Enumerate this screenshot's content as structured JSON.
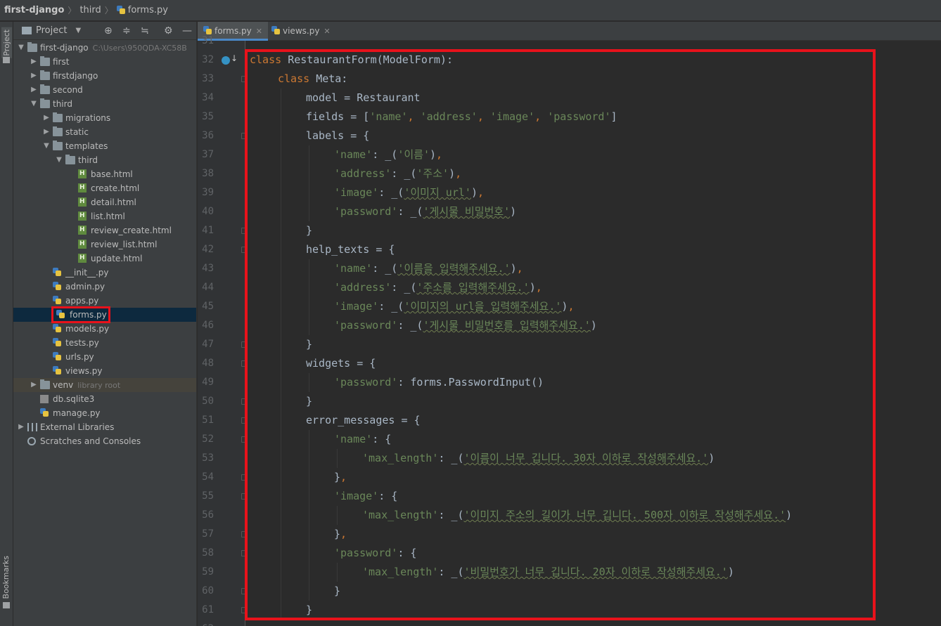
{
  "breadcrumb": [
    "first-django",
    "third",
    "forms.py"
  ],
  "sidebar_strip": {
    "project_label": "Project",
    "bookmarks_label": "Bookmarks"
  },
  "project_panel": {
    "title": "Project"
  },
  "tree": [
    {
      "label": "first-django",
      "hint": "C:\\Users\\950QDA-XC58B",
      "depth": 0,
      "arrow": "down",
      "icon": "folder-icon"
    },
    {
      "label": "first",
      "depth": 1,
      "arrow": "right",
      "icon": "folder-icon"
    },
    {
      "label": "firstdjango",
      "depth": 1,
      "arrow": "right",
      "icon": "folder-icon"
    },
    {
      "label": "second",
      "depth": 1,
      "arrow": "right",
      "icon": "folder-icon"
    },
    {
      "label": "third",
      "depth": 1,
      "arrow": "down",
      "icon": "folder-icon"
    },
    {
      "label": "migrations",
      "depth": 2,
      "arrow": "right",
      "icon": "folder-icon"
    },
    {
      "label": "static",
      "depth": 2,
      "arrow": "right",
      "icon": "folder-icon"
    },
    {
      "label": "templates",
      "depth": 2,
      "arrow": "down",
      "icon": "folder-icon"
    },
    {
      "label": "third",
      "depth": 3,
      "arrow": "down",
      "icon": "folder-icon"
    },
    {
      "label": "base.html",
      "depth": 4,
      "icon": "html-file-icon"
    },
    {
      "label": "create.html",
      "depth": 4,
      "icon": "html-file-icon"
    },
    {
      "label": "detail.html",
      "depth": 4,
      "icon": "html-file-icon"
    },
    {
      "label": "list.html",
      "depth": 4,
      "icon": "html-file-icon"
    },
    {
      "label": "review_create.html",
      "depth": 4,
      "icon": "html-file-icon"
    },
    {
      "label": "review_list.html",
      "depth": 4,
      "icon": "html-file-icon"
    },
    {
      "label": "update.html",
      "depth": 4,
      "icon": "html-file-icon"
    },
    {
      "label": "__init__.py",
      "depth": 2,
      "icon": "python-file-icon"
    },
    {
      "label": "admin.py",
      "depth": 2,
      "icon": "python-file-icon"
    },
    {
      "label": "apps.py",
      "depth": 2,
      "icon": "python-file-icon"
    },
    {
      "label": "forms.py",
      "depth": 2,
      "icon": "python-file-icon",
      "selected": true
    },
    {
      "label": "models.py",
      "depth": 2,
      "icon": "python-file-icon"
    },
    {
      "label": "tests.py",
      "depth": 2,
      "icon": "python-file-icon"
    },
    {
      "label": "urls.py",
      "depth": 2,
      "icon": "python-file-icon"
    },
    {
      "label": "views.py",
      "depth": 2,
      "icon": "python-file-icon"
    },
    {
      "label": "venv",
      "hint": "library root",
      "depth": 1,
      "arrow": "right",
      "icon": "folder-icon",
      "venv": true
    },
    {
      "label": "db.sqlite3",
      "depth": 1,
      "icon": "database-icon"
    },
    {
      "label": "manage.py",
      "depth": 1,
      "icon": "python-file-icon"
    },
    {
      "label": "External Libraries",
      "depth": 0,
      "arrow": "right",
      "icon": "library-icon"
    },
    {
      "label": "Scratches and Consoles",
      "depth": 0,
      "icon": "scratch-icon"
    }
  ],
  "editor_tabs": [
    {
      "label": "forms.py",
      "active": true,
      "closable": true
    },
    {
      "label": "views.py",
      "active": false,
      "closable": true
    }
  ],
  "code": {
    "first_line_number": 31,
    "lines": [
      {
        "n": 31,
        "indent": 0,
        "parts": []
      },
      {
        "n": 32,
        "indent": 0,
        "parts": [
          [
            "kw",
            "class "
          ],
          [
            "cls",
            "RestaurantForm(ModelForm):"
          ]
        ]
      },
      {
        "n": 33,
        "indent": 1,
        "parts": [
          [
            "kw",
            "class "
          ],
          [
            "cls",
            "Meta:"
          ]
        ]
      },
      {
        "n": 34,
        "indent": 2,
        "parts": [
          [
            "cls",
            "model = Restaurant"
          ]
        ]
      },
      {
        "n": 35,
        "indent": 2,
        "parts": [
          [
            "cls",
            "fields = ["
          ],
          [
            "str",
            "'name'"
          ],
          [
            "punc",
            ", "
          ],
          [
            "str",
            "'address'"
          ],
          [
            "punc",
            ", "
          ],
          [
            "str",
            "'image'"
          ],
          [
            "punc",
            ", "
          ],
          [
            "str",
            "'password'"
          ],
          [
            "cls",
            "]"
          ]
        ]
      },
      {
        "n": 36,
        "indent": 2,
        "parts": [
          [
            "cls",
            "labels = {"
          ]
        ]
      },
      {
        "n": 37,
        "indent": 3,
        "parts": [
          [
            "str",
            "'name'"
          ],
          [
            "cls",
            ": _("
          ],
          [
            "str",
            "'이름'"
          ],
          [
            "cls",
            ")"
          ],
          [
            "punc",
            ","
          ]
        ]
      },
      {
        "n": 38,
        "indent": 3,
        "parts": [
          [
            "str",
            "'address'"
          ],
          [
            "cls",
            ": _("
          ],
          [
            "str",
            "'주소'"
          ],
          [
            "cls",
            ")"
          ],
          [
            "punc",
            ","
          ]
        ]
      },
      {
        "n": 39,
        "indent": 3,
        "parts": [
          [
            "str",
            "'image'"
          ],
          [
            "cls",
            ": _("
          ],
          [
            "str",
            "'이미지 url'"
          ],
          [
            "cls",
            ")"
          ],
          [
            "punc",
            ","
          ]
        ]
      },
      {
        "n": 40,
        "indent": 3,
        "parts": [
          [
            "str",
            "'password'"
          ],
          [
            "cls",
            ": _("
          ],
          [
            "str",
            "'게시물 비밀번호'"
          ],
          [
            "cls",
            ")"
          ]
        ]
      },
      {
        "n": 41,
        "indent": 2,
        "parts": [
          [
            "cls",
            "}"
          ]
        ]
      },
      {
        "n": 42,
        "indent": 2,
        "parts": [
          [
            "cls",
            "help_texts = {"
          ]
        ]
      },
      {
        "n": 43,
        "indent": 3,
        "parts": [
          [
            "str",
            "'name'"
          ],
          [
            "cls",
            ": _("
          ],
          [
            "str",
            "'이름을 입력해주세요.'"
          ],
          [
            "cls",
            ")"
          ],
          [
            "punc",
            ","
          ]
        ]
      },
      {
        "n": 44,
        "indent": 3,
        "parts": [
          [
            "str",
            "'address'"
          ],
          [
            "cls",
            ": _("
          ],
          [
            "str",
            "'주소를 입력해주세요.'"
          ],
          [
            "cls",
            ")"
          ],
          [
            "punc",
            ","
          ]
        ]
      },
      {
        "n": 45,
        "indent": 3,
        "parts": [
          [
            "str",
            "'image'"
          ],
          [
            "cls",
            ": _("
          ],
          [
            "str",
            "'이미지의 url을 입력해주세요.'"
          ],
          [
            "cls",
            ")"
          ],
          [
            "punc",
            ","
          ]
        ]
      },
      {
        "n": 46,
        "indent": 3,
        "parts": [
          [
            "str",
            "'password'"
          ],
          [
            "cls",
            ": _("
          ],
          [
            "str",
            "'게시물 비밀번호를 입력해주세요.'"
          ],
          [
            "cls",
            ")"
          ]
        ]
      },
      {
        "n": 47,
        "indent": 2,
        "parts": [
          [
            "cls",
            "}"
          ]
        ]
      },
      {
        "n": 48,
        "indent": 2,
        "parts": [
          [
            "cls",
            "widgets = {"
          ]
        ]
      },
      {
        "n": 49,
        "indent": 3,
        "parts": [
          [
            "str",
            "'password'"
          ],
          [
            "cls",
            ": forms.PasswordInput()"
          ]
        ]
      },
      {
        "n": 50,
        "indent": 2,
        "parts": [
          [
            "cls",
            "}"
          ]
        ]
      },
      {
        "n": 51,
        "indent": 2,
        "parts": [
          [
            "cls",
            "error_messages = {"
          ]
        ]
      },
      {
        "n": 52,
        "indent": 3,
        "parts": [
          [
            "str",
            "'name'"
          ],
          [
            "cls",
            ": {"
          ]
        ]
      },
      {
        "n": 53,
        "indent": 4,
        "parts": [
          [
            "str",
            "'max_length'"
          ],
          [
            "cls",
            ": _("
          ],
          [
            "str",
            "'이름이 너무 깁니다. 30자 이하로 작성해주세요.'"
          ],
          [
            "cls",
            ")"
          ]
        ]
      },
      {
        "n": 54,
        "indent": 3,
        "parts": [
          [
            "cls",
            "}"
          ],
          [
            "punc",
            ","
          ]
        ]
      },
      {
        "n": 55,
        "indent": 3,
        "parts": [
          [
            "str",
            "'image'"
          ],
          [
            "cls",
            ": {"
          ]
        ]
      },
      {
        "n": 56,
        "indent": 4,
        "parts": [
          [
            "str",
            "'max_length'"
          ],
          [
            "cls",
            ": _("
          ],
          [
            "str",
            "'이미지 주소의 길이가 너무 깁니다. 500자 이하로 작성해주세요.'"
          ],
          [
            "cls",
            ")"
          ]
        ]
      },
      {
        "n": 57,
        "indent": 3,
        "parts": [
          [
            "cls",
            "}"
          ],
          [
            "punc",
            ","
          ]
        ]
      },
      {
        "n": 58,
        "indent": 3,
        "parts": [
          [
            "str",
            "'password'"
          ],
          [
            "cls",
            ": {"
          ]
        ]
      },
      {
        "n": 59,
        "indent": 4,
        "parts": [
          [
            "str",
            "'max_length'"
          ],
          [
            "cls",
            ": _("
          ],
          [
            "str",
            "'비밀번호가 너무 깁니다. 20자 이하로 작성해주세요.'"
          ],
          [
            "cls",
            ")"
          ]
        ]
      },
      {
        "n": 60,
        "indent": 3,
        "parts": [
          [
            "cls",
            "}"
          ]
        ]
      },
      {
        "n": 61,
        "indent": 2,
        "parts": [
          [
            "cls",
            "}"
          ]
        ]
      },
      {
        "n": 62,
        "indent": 0,
        "parts": []
      }
    ]
  },
  "colors": {
    "keyword": "#cc7832",
    "string": "#6a8759",
    "text": "#a9b7c6",
    "highlight_box": "#e8121b",
    "selection": "#0d293e"
  }
}
